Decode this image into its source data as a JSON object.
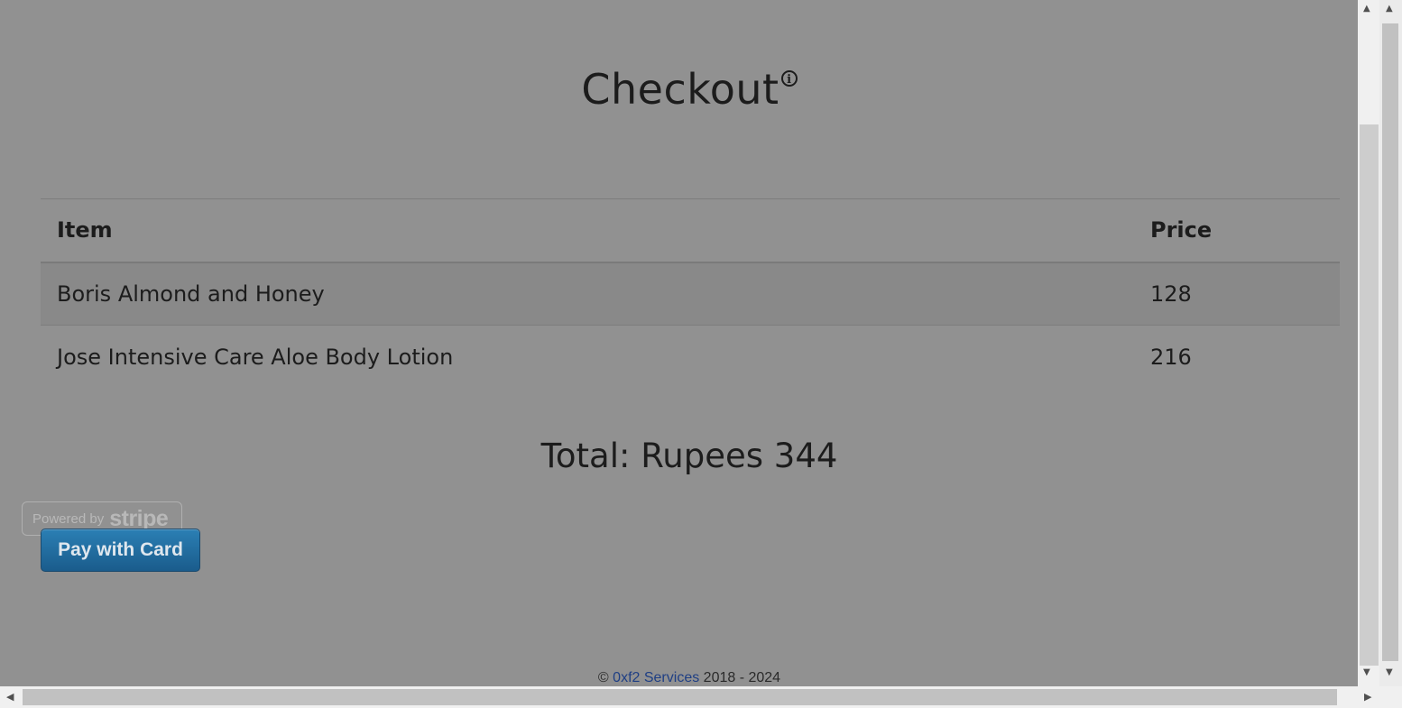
{
  "header": {
    "title": "Checkout",
    "info_glyph": "i"
  },
  "table": {
    "columns": [
      "Item",
      "Price"
    ],
    "rows": [
      {
        "item": "Boris Almond and Honey",
        "price": "128"
      },
      {
        "item": "Jose Intensive Care Aloe Body Lotion",
        "price": "216"
      }
    ]
  },
  "total": {
    "label": "Total: Rupees 344"
  },
  "payment": {
    "powered_by": "Powered by",
    "brand": "stripe",
    "button_label": "Pay with Card"
  },
  "footer": {
    "copyright": "©",
    "company": "0xf2 Services",
    "years": "2018 - 2024"
  },
  "icons": {
    "info": "info-icon",
    "scroll_up": "chevron-up-icon",
    "scroll_down": "chevron-down-icon",
    "scroll_left": "chevron-left-icon",
    "scroll_right": "chevron-right-icon"
  },
  "colors": {
    "overlay": "#919191",
    "pay_button": "#1f6a9f",
    "footer_link": "#1f3f84"
  }
}
